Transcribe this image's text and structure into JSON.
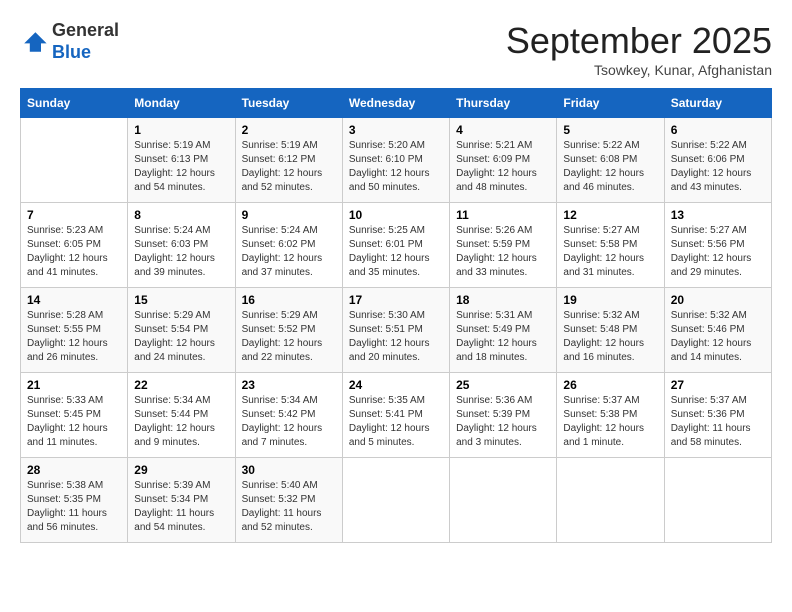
{
  "header": {
    "logo_line1": "General",
    "logo_line2": "Blue",
    "month": "September 2025",
    "location": "Tsowkey, Kunar, Afghanistan"
  },
  "weekdays": [
    "Sunday",
    "Monday",
    "Tuesday",
    "Wednesday",
    "Thursday",
    "Friday",
    "Saturday"
  ],
  "weeks": [
    [
      {
        "day": "",
        "sunrise": "",
        "sunset": "",
        "daylight": ""
      },
      {
        "day": "1",
        "sunrise": "5:19 AM",
        "sunset": "6:13 PM",
        "daylight": "12 hours and 54 minutes."
      },
      {
        "day": "2",
        "sunrise": "5:19 AM",
        "sunset": "6:12 PM",
        "daylight": "12 hours and 52 minutes."
      },
      {
        "day": "3",
        "sunrise": "5:20 AM",
        "sunset": "6:10 PM",
        "daylight": "12 hours and 50 minutes."
      },
      {
        "day": "4",
        "sunrise": "5:21 AM",
        "sunset": "6:09 PM",
        "daylight": "12 hours and 48 minutes."
      },
      {
        "day": "5",
        "sunrise": "5:22 AM",
        "sunset": "6:08 PM",
        "daylight": "12 hours and 46 minutes."
      },
      {
        "day": "6",
        "sunrise": "5:22 AM",
        "sunset": "6:06 PM",
        "daylight": "12 hours and 43 minutes."
      }
    ],
    [
      {
        "day": "7",
        "sunrise": "5:23 AM",
        "sunset": "6:05 PM",
        "daylight": "12 hours and 41 minutes."
      },
      {
        "day": "8",
        "sunrise": "5:24 AM",
        "sunset": "6:03 PM",
        "daylight": "12 hours and 39 minutes."
      },
      {
        "day": "9",
        "sunrise": "5:24 AM",
        "sunset": "6:02 PM",
        "daylight": "12 hours and 37 minutes."
      },
      {
        "day": "10",
        "sunrise": "5:25 AM",
        "sunset": "6:01 PM",
        "daylight": "12 hours and 35 minutes."
      },
      {
        "day": "11",
        "sunrise": "5:26 AM",
        "sunset": "5:59 PM",
        "daylight": "12 hours and 33 minutes."
      },
      {
        "day": "12",
        "sunrise": "5:27 AM",
        "sunset": "5:58 PM",
        "daylight": "12 hours and 31 minutes."
      },
      {
        "day": "13",
        "sunrise": "5:27 AM",
        "sunset": "5:56 PM",
        "daylight": "12 hours and 29 minutes."
      }
    ],
    [
      {
        "day": "14",
        "sunrise": "5:28 AM",
        "sunset": "5:55 PM",
        "daylight": "12 hours and 26 minutes."
      },
      {
        "day": "15",
        "sunrise": "5:29 AM",
        "sunset": "5:54 PM",
        "daylight": "12 hours and 24 minutes."
      },
      {
        "day": "16",
        "sunrise": "5:29 AM",
        "sunset": "5:52 PM",
        "daylight": "12 hours and 22 minutes."
      },
      {
        "day": "17",
        "sunrise": "5:30 AM",
        "sunset": "5:51 PM",
        "daylight": "12 hours and 20 minutes."
      },
      {
        "day": "18",
        "sunrise": "5:31 AM",
        "sunset": "5:49 PM",
        "daylight": "12 hours and 18 minutes."
      },
      {
        "day": "19",
        "sunrise": "5:32 AM",
        "sunset": "5:48 PM",
        "daylight": "12 hours and 16 minutes."
      },
      {
        "day": "20",
        "sunrise": "5:32 AM",
        "sunset": "5:46 PM",
        "daylight": "12 hours and 14 minutes."
      }
    ],
    [
      {
        "day": "21",
        "sunrise": "5:33 AM",
        "sunset": "5:45 PM",
        "daylight": "12 hours and 11 minutes."
      },
      {
        "day": "22",
        "sunrise": "5:34 AM",
        "sunset": "5:44 PM",
        "daylight": "12 hours and 9 minutes."
      },
      {
        "day": "23",
        "sunrise": "5:34 AM",
        "sunset": "5:42 PM",
        "daylight": "12 hours and 7 minutes."
      },
      {
        "day": "24",
        "sunrise": "5:35 AM",
        "sunset": "5:41 PM",
        "daylight": "12 hours and 5 minutes."
      },
      {
        "day": "25",
        "sunrise": "5:36 AM",
        "sunset": "5:39 PM",
        "daylight": "12 hours and 3 minutes."
      },
      {
        "day": "26",
        "sunrise": "5:37 AM",
        "sunset": "5:38 PM",
        "daylight": "12 hours and 1 minute."
      },
      {
        "day": "27",
        "sunrise": "5:37 AM",
        "sunset": "5:36 PM",
        "daylight": "11 hours and 58 minutes."
      }
    ],
    [
      {
        "day": "28",
        "sunrise": "5:38 AM",
        "sunset": "5:35 PM",
        "daylight": "11 hours and 56 minutes."
      },
      {
        "day": "29",
        "sunrise": "5:39 AM",
        "sunset": "5:34 PM",
        "daylight": "11 hours and 54 minutes."
      },
      {
        "day": "30",
        "sunrise": "5:40 AM",
        "sunset": "5:32 PM",
        "daylight": "11 hours and 52 minutes."
      },
      {
        "day": "",
        "sunrise": "",
        "sunset": "",
        "daylight": ""
      },
      {
        "day": "",
        "sunrise": "",
        "sunset": "",
        "daylight": ""
      },
      {
        "day": "",
        "sunrise": "",
        "sunset": "",
        "daylight": ""
      },
      {
        "day": "",
        "sunrise": "",
        "sunset": "",
        "daylight": ""
      }
    ]
  ]
}
